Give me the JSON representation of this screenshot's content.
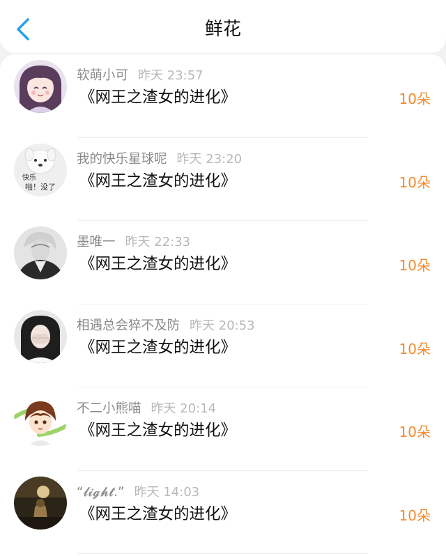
{
  "header": {
    "title": "鲜花",
    "back_icon": "chevron-left-icon",
    "accent_color": "#2aa0ee"
  },
  "rows": [
    {
      "name": "软萌小可",
      "time": "昨天 23:57",
      "book": "《网王之渣女的进化》",
      "count": "10朵"
    },
    {
      "name": "我的快乐星球呢",
      "time": "昨天 23:20",
      "book": "《网王之渣女的进化》",
      "count": "10朵",
      "avatar_text": [
        "快乐",
        "啪！没了"
      ]
    },
    {
      "name": "墨唯一",
      "time": "昨天 22:33",
      "book": "《网王之渣女的进化》",
      "count": "10朵"
    },
    {
      "name": "相遇总会猝不及防",
      "time": "昨天 20:53",
      "book": "《网王之渣女的进化》",
      "count": "10朵"
    },
    {
      "name": "不二小熊喵",
      "time": "昨天 20:14",
      "book": "《网王之渣女的进化》",
      "count": "10朵"
    },
    {
      "name": "“𝓵𝓲𝓰𝓱𝓽.”",
      "time": "昨天 14:03",
      "book": "《网王之渣女的进化》",
      "count": "10朵"
    }
  ],
  "colors": {
    "count": "#f08a2c",
    "name": "#8a8a8a",
    "time": "#b8b8b8"
  }
}
